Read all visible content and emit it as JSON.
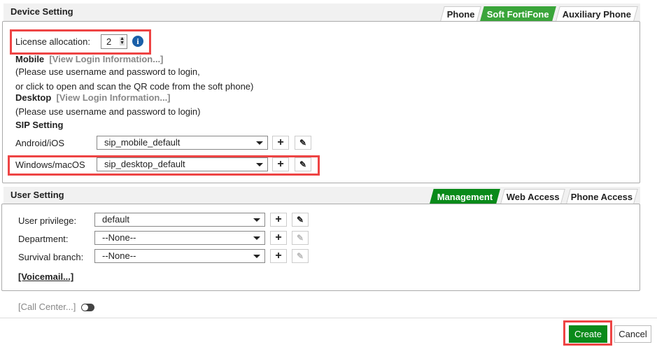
{
  "device": {
    "title": "Device Setting",
    "tabs": [
      "Phone",
      "Soft FortiFone",
      "Auxiliary Phone"
    ],
    "license_label": "License allocation:",
    "license_value": "2",
    "mobile_label": "Mobile",
    "view_login": "[View Login Information...]",
    "mobile_note1": "(Please use username and password to login,",
    "mobile_note2": "or click to open and scan the QR code from the soft phone)",
    "desktop_label": "Desktop",
    "desktop_note": "(Please use username and password to login)",
    "sip_title": "SIP Setting",
    "android_label": "Android/iOS",
    "android_value": "sip_mobile_default",
    "windows_label": "Windows/macOS",
    "windows_value": "sip_desktop_default"
  },
  "user": {
    "title": "User Setting",
    "tabs": [
      "Management",
      "Web Access",
      "Phone Access"
    ],
    "privilege_label": "User privilege:",
    "privilege_value": "default",
    "department_label": "Department:",
    "department_value": "--None--",
    "survival_label": "Survival branch:",
    "survival_value": "--None--",
    "voicemail": "[Voicemail...]"
  },
  "call_center": "[Call Center...]",
  "buttons": {
    "create": "Create",
    "cancel": "Cancel",
    "plus": "+",
    "edit": "✎"
  },
  "colors": {
    "active_tab": "#3aa53a",
    "primary": "#0a8a1a",
    "highlight": "#ee4444"
  }
}
